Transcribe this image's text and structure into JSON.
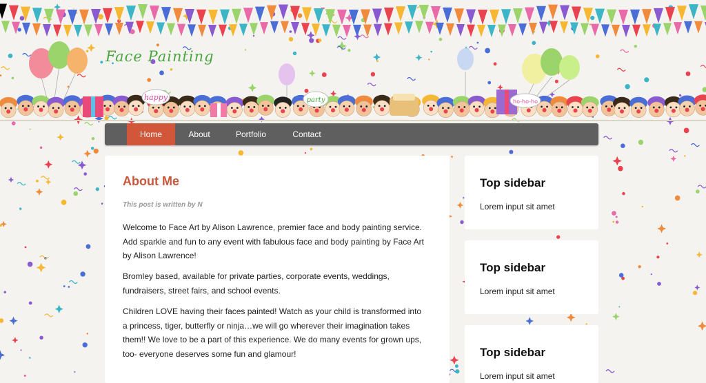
{
  "site": {
    "title": "Face Painting"
  },
  "nav": {
    "items": [
      {
        "label": "Home",
        "active": true
      },
      {
        "label": "About",
        "active": false
      },
      {
        "label": "Portfolio",
        "active": false
      },
      {
        "label": "Contact",
        "active": false
      }
    ]
  },
  "header_badges": {
    "happy": "happy",
    "party": "party",
    "hohoho": "ho-ho-ho"
  },
  "post": {
    "title": "About Me",
    "byline": "This post is written by N",
    "paragraphs": [
      "Welcome to Face Art by Alison Lawrence, premier face and body painting service. Add sparkle and fun to any event with fabulous face and body painting by Face Art by Alison Lawrence!",
      "Bromley based, available for private parties, corporate events, weddings, fundraisers, street fairs, and school events.",
      "Children LOVE having their faces painted! Watch as your child is transformed into a princess, tiger, butterfly or ninja…we will go wherever their imagination takes them!! We love to be a part of this experience. We do many events for grown ups, too- everyone deserves some fun and glamour!"
    ]
  },
  "sidebar": {
    "widgets": [
      {
        "title": "Top sidebar",
        "text": "Lorem input sit amet"
      },
      {
        "title": "Top sidebar",
        "text": "Lorem input sit amet"
      },
      {
        "title": "Top sidebar",
        "text": "Lorem input sit amet"
      }
    ]
  },
  "colors": {
    "accent": "#d2573a",
    "nav_bg": "#5f5f5f",
    "title_green": "#4aa640",
    "post_title": "#c9573c",
    "page_bg": "#f4f3ef"
  }
}
